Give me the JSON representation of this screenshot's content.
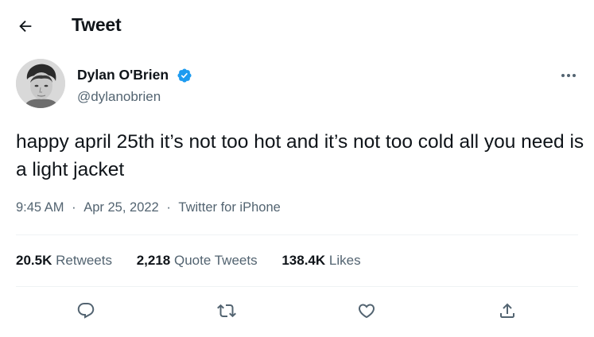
{
  "header": {
    "title": "Tweet",
    "back_icon": "arrow-left-icon"
  },
  "author": {
    "name": "Dylan O'Brien",
    "handle": "@dylanobrien",
    "verified": true,
    "verified_color": "#1d9bf0"
  },
  "tweet": {
    "text": "happy april 25th it’s not too hot and it’s not too cold all you need is a light jacket",
    "time": "9:45 AM",
    "date": "Apr 25, 2022",
    "source": "Twitter for iPhone",
    "separator": "·"
  },
  "stats": [
    {
      "value": "20.5K",
      "label": "Retweets"
    },
    {
      "value": "2,218",
      "label": "Quote Tweets"
    },
    {
      "value": "138.4K",
      "label": "Likes"
    }
  ],
  "actions": [
    {
      "name": "reply",
      "icon": "reply-icon"
    },
    {
      "name": "retweet",
      "icon": "retweet-icon"
    },
    {
      "name": "like",
      "icon": "heart-icon"
    },
    {
      "name": "share",
      "icon": "share-icon"
    }
  ],
  "colors": {
    "text": "#0f1419",
    "secondary": "#536471",
    "divider": "#eff3f4",
    "accent": "#1d9bf0"
  }
}
